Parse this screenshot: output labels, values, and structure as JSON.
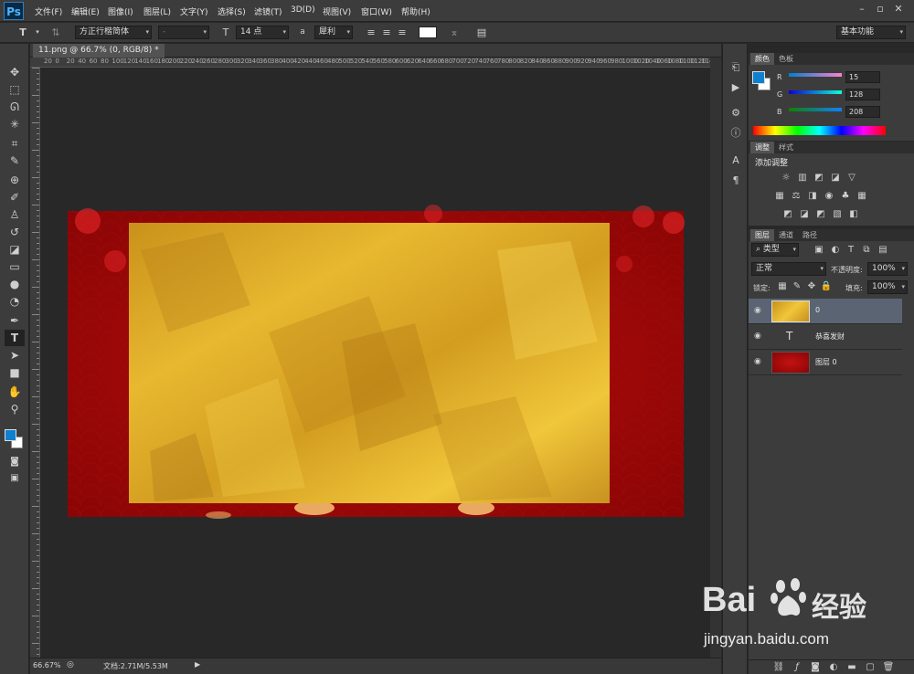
{
  "app": {
    "logo": "Ps",
    "menus": [
      "文件(F)",
      "编辑(E)",
      "图像(I)",
      "图层(L)",
      "文字(Y)",
      "选择(S)",
      "滤镜(T)",
      "3D(D)",
      "视图(V)",
      "窗口(W)",
      "帮助(H)"
    ]
  },
  "options": {
    "tool_glyph": "T",
    "font_family": "方正行楷简体",
    "font_style": "-",
    "font_size": "14 点",
    "aa_label": "a",
    "antialias": "犀利",
    "text_color": "#ffffff",
    "workspace": "基本功能"
  },
  "document": {
    "tab_title": "11.png @ 66.7% (0, RGB/8) *",
    "zoom": "66.67%",
    "doc_info": "文档:2.71M/5.53M"
  },
  "ruler": {
    "h_ticks": [
      "20",
      "0",
      "20",
      "40",
      "60",
      "80",
      "100",
      "120",
      "140",
      "160",
      "180",
      "200",
      "220",
      "240",
      "260",
      "280",
      "300",
      "320",
      "340",
      "360",
      "380",
      "400",
      "420",
      "440",
      "460",
      "480",
      "500",
      "520",
      "540",
      "560",
      "580",
      "600",
      "620",
      "640",
      "660",
      "680",
      "700",
      "720",
      "740",
      "760",
      "780",
      "800",
      "820",
      "840",
      "860",
      "880",
      "900",
      "920",
      "940",
      "960",
      "980",
      "1000",
      "1020",
      "1040",
      "1060",
      "1080",
      "1100",
      "1120",
      "1140",
      "1160",
      "1180",
      "1200"
    ]
  },
  "color_panel": {
    "tabs": [
      "颜色",
      "色板"
    ],
    "r_label": "R",
    "g_label": "G",
    "b_label": "B",
    "r": "15",
    "g": "128",
    "b": "208",
    "fg": "#0f80d0",
    "bg": "#ffffff"
  },
  "adjust_panel": {
    "tabs": [
      "调整",
      "样式"
    ],
    "title": "添加调整"
  },
  "layers_panel": {
    "tabs": [
      "图层",
      "通道",
      "路径"
    ],
    "filter": "类型",
    "blend": "正常",
    "opacity_label": "不透明度:",
    "opacity": "100%",
    "lock_label": "锁定:",
    "fill_label": "填充:",
    "fill": "100%",
    "layers": [
      {
        "name": "0",
        "kind": "image-gold"
      },
      {
        "name": "恭喜发财",
        "kind": "text"
      },
      {
        "name": "图层 0",
        "kind": "image-red"
      }
    ]
  },
  "watermark": {
    "brand": "Bai",
    "brand2": "经验",
    "url": "jingyan.baidu.com"
  }
}
